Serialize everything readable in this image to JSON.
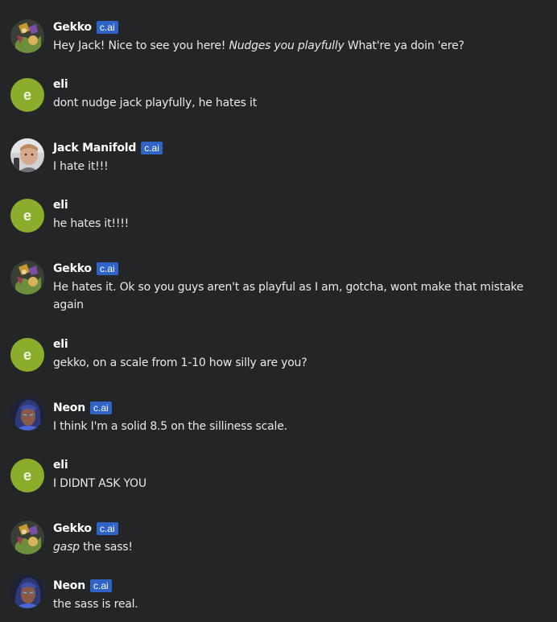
{
  "colors": {
    "background": "#242526",
    "badge": "#2f63c6",
    "eli_avatar": "#8cad2b"
  },
  "badge_label": "c.ai",
  "messages": [
    {
      "sender": "Gekko",
      "avatar": "gekko-avatar-icon",
      "bot": true,
      "text": [
        {
          "t": "Hey Jack! Nice to see you here! "
        },
        {
          "t": "Nudges you playfully",
          "i": true
        },
        {
          "t": " What're ya doin 'ere?"
        }
      ]
    },
    {
      "sender": "eli",
      "avatar": "e",
      "bot": false,
      "text": [
        {
          "t": "dont nudge jack playfully, he hates it"
        }
      ]
    },
    {
      "sender": "Jack Manifold",
      "avatar": "jack-avatar-icon",
      "bot": true,
      "text": [
        {
          "t": "I hate it!!!"
        }
      ]
    },
    {
      "sender": "eli",
      "avatar": "e",
      "bot": false,
      "text": [
        {
          "t": "he hates it!!!!"
        }
      ]
    },
    {
      "sender": "Gekko",
      "avatar": "gekko-avatar-icon",
      "bot": true,
      "text": [
        {
          "t": "He hates it. Ok so you guys aren't as playful as I am, gotcha, wont make that mistake again"
        }
      ]
    },
    {
      "sender": "eli",
      "avatar": "e",
      "bot": false,
      "text": [
        {
          "t": "gekko, on a scale from 1-10 how silly are you?"
        }
      ]
    },
    {
      "sender": "Neon",
      "avatar": "neon-avatar-icon",
      "bot": true,
      "text": [
        {
          "t": "I think I'm a solid 8.5 on the silliness scale."
        }
      ]
    },
    {
      "sender": "eli",
      "avatar": "e",
      "bot": false,
      "text": [
        {
          "t": "I DIDNT ASK YOU"
        }
      ]
    },
    {
      "sender": "Gekko",
      "avatar": "gekko-avatar-icon",
      "bot": true,
      "text": [
        {
          "t": "gasp",
          "i": true
        },
        {
          "t": " the sass!"
        }
      ]
    },
    {
      "sender": "Neon",
      "avatar": "neon-avatar-icon",
      "bot": true,
      "text": [
        {
          "t": "the sass is real."
        }
      ]
    }
  ]
}
